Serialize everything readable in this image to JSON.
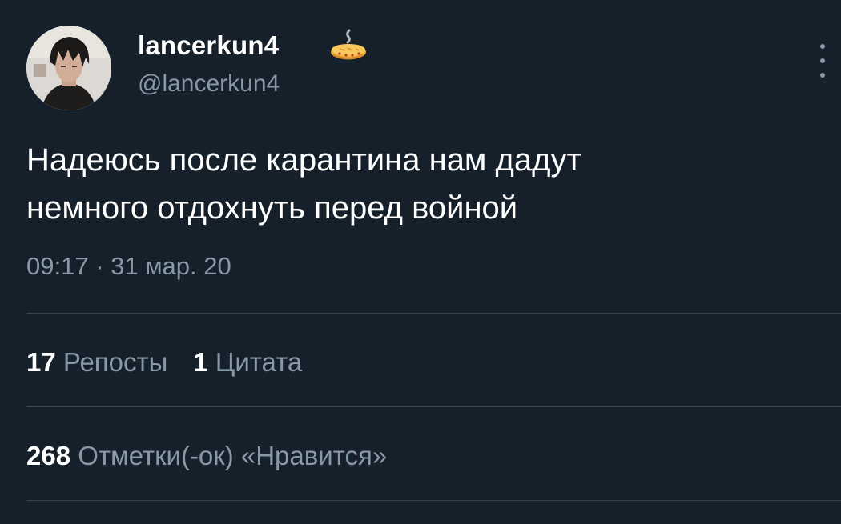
{
  "user": {
    "display_name": "lancerkun4",
    "handle": "@lancerkun4",
    "badge_icon": "pie-icon",
    "avatar_icon": "avatar"
  },
  "tweet": {
    "text_line1": "Надеюсь после карантина нам дадут",
    "text_line2": "немного отдохнуть перед войной",
    "timestamp": "09:17 · 31 мар. 20"
  },
  "stats": {
    "retweets_count": "17",
    "retweets_label": "Репосты",
    "quotes_count": "1",
    "quotes_label": "Цитата",
    "likes_count": "268",
    "likes_label": "Отметки(-ок) «Нравится»"
  },
  "colors": {
    "background": "#15202b",
    "primary_text": "#ffffff",
    "secondary_text": "#8899a6",
    "divider": "#38444d"
  }
}
